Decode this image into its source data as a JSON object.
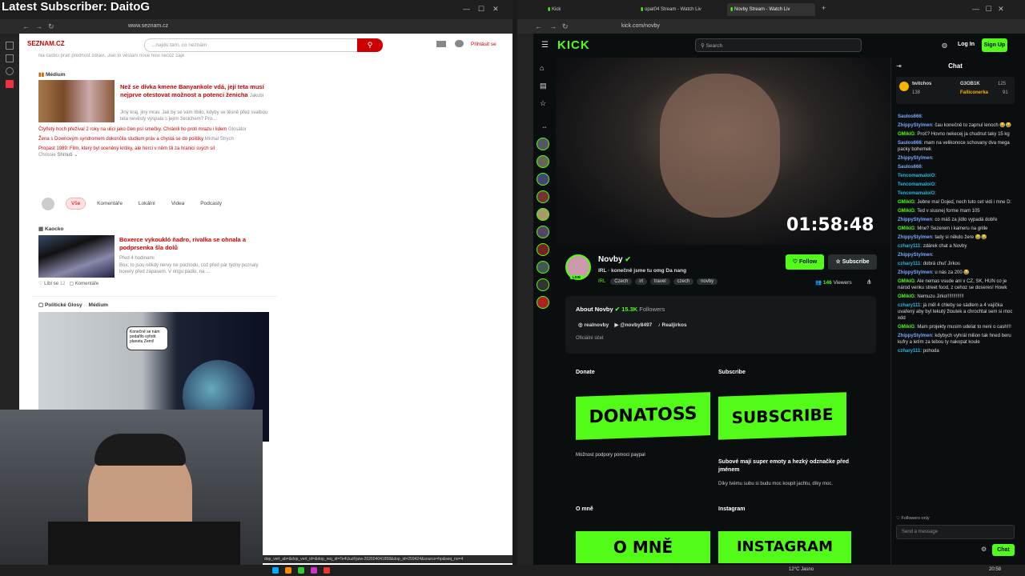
{
  "overlay": {
    "title": "Latest Subscriber: DaitoG"
  },
  "left_browser": {
    "url": "www.seznam.cz",
    "logo": "SEZNAM.CZ",
    "search_placeholder": "...najdu tam, co neznám",
    "login": "Přihlásit se",
    "cut_text": "Na častici prátí předhost zdraví. Jsel to věstání nové novi necož zaje",
    "medium_source": "Médium",
    "headline": "Než se dívka kmene Banyankole vdá, její teta musí nejprve otestovat možnost a potenci ženicha",
    "headline_author": "Jakubi",
    "headline_excerpt": "Jiný kraj, jiný mrav. Jak by se vám líbilo, kdyby se těsně před svatbou teta nevěsty vyspala s jejím ženichem? Pro...",
    "links": [
      {
        "title": "Čtyřletý hoch přežíval 2 roky na ulici jako člen psí smečky. Chránili ho proti mrazu i lidem",
        "source": "Glosátor"
      },
      {
        "title": "Žena s Downovým syndromem dokončila studium práv a chystá se do politiky",
        "source": "Michal Strych"
      },
      {
        "title": "Propast 1989: Film, který byl oceněný kritiky, ale herci v něm šli za hranici svých sil",
        "source": "Chrissie",
        "extra": "Shrnutí ⌄"
      }
    ],
    "filters": [
      "Vše",
      "Komentáře",
      "Lokální",
      "Videa",
      "Podcasty"
    ],
    "kaocko_source": "Kaocko",
    "kaocko_title": "Boxerce vykoukló ňadro, rivalka se ohnala a podprsenka šla dolů",
    "kaocko_meta": "Před 4 hodinami",
    "kaocko_text": "Box, to jsou někdy nervy ne pochodu, což před pár týdny poznaly boxery před zápasem. V ringu padlo, na ...",
    "likes": "Líbí se",
    "likes_count": "12",
    "comments": "Komentáře",
    "glosy_source": "Politické Glosy",
    "glosy_medium": "Médium",
    "comic_text": "Konečně se nám podařilo vyfotit planetu Zemi!",
    "status_url": "dop_vert_ab=&dop_vert_id=&dop_req_id=Te4UuzFjuiw-202604041858&dop_id=259424&source=hp&seq_no=4"
  },
  "right_browser": {
    "tabs": [
      "Kick",
      "opat04 Stream - Watch Liv",
      "Novby Stream - Watch Liv"
    ],
    "url": "kick.com/novby",
    "search_placeholder": "Search",
    "login": "Log In",
    "signup": "Sign Up",
    "timer": "01:58:48",
    "streamer": "Novby",
    "stream_title": "IRL · konečně jsme tu omg Da nang",
    "category": "IRL",
    "tags": [
      "Czech",
      "irl",
      "travel",
      "czech",
      "novby"
    ],
    "follow": "Follow",
    "subscribe": "Subscribe",
    "viewers": "146",
    "viewers_label": "Viewers",
    "about": "About Novby",
    "followers": "15.3K",
    "followers_label": "Followers",
    "socials": [
      "realnovby",
      "@novby8497",
      "Realjirkos"
    ],
    "official": "Oficiální účet",
    "donate_title": "Donate",
    "donate_banner": "DONATOSS",
    "donate_desc": "Možnost podpory pomocí paypal",
    "subscribe_title": "Subscribe",
    "subscribe_banner": "SUBSCRIBE",
    "subscribe_desc": "Subové mají super emoty a hezký odznačke před jménem",
    "subscribe_desc2": "Díky tvému subu si budu moc koupit jachtu, díky moc.",
    "omne_title": "O mně",
    "omne_banner": "O MNĚ",
    "instagram_title": "Instagram",
    "instagram_banner": "INSTAGRAM",
    "chat_title": "Chat",
    "pinned": {
      "user1": "twitchos",
      "count1": "138",
      "user2": "G3OB1K",
      "count2": "125",
      "user3": "Falliconerka",
      "count3": "91"
    },
    "chat": [
      {
        "u": "Saulos666",
        "c": "blue",
        "m": ""
      },
      {
        "u": "ZhippyStylmen",
        "c": "blue",
        "m": "čau konečně to zapnul lenoch 😂😂"
      },
      {
        "u": "GMikiG",
        "c": "green",
        "m": "Proč? Hovno nekecej ja chudnut taky 15 kg"
      },
      {
        "u": "Saulos666",
        "c": "blue",
        "m": "mam na velikonoce schovany dva mega packy bohemek"
      },
      {
        "u": "ZhippyStylmen",
        "c": "blue",
        "m": ""
      },
      {
        "u": "Saulos666",
        "c": "blue",
        "m": ""
      },
      {
        "u": "TencomamaloiO",
        "c": "cyan",
        "m": ""
      },
      {
        "u": "TencomamaloiO",
        "c": "cyan",
        "m": ""
      },
      {
        "u": "TencomamaloiO",
        "c": "cyan",
        "m": ""
      },
      {
        "u": "GMikiG",
        "c": "green",
        "m": "Jebne ma! Dojed, nech tuto cet vidi i mne D:"
      },
      {
        "u": "GMikiG",
        "c": "green",
        "m": "Ted v slusnej forme mam 105"
      },
      {
        "u": "ZhippyStylmen",
        "c": "blue",
        "m": "co máš za jídlo vypadá dobře"
      },
      {
        "u": "GMikiG",
        "c": "green",
        "m": "Mne? Sezerem i kameru na grille"
      },
      {
        "u": "ZhippyStylmen",
        "c": "blue",
        "m": "tady si někdo žere 😂😂"
      },
      {
        "u": "czhary111",
        "c": "cyan",
        "m": "zdárek chat a Novby"
      },
      {
        "u": "ZhippyStylmen",
        "c": "blue",
        "m": ""
      },
      {
        "u": "czhary111",
        "c": "cyan",
        "m": "dobrá chuť Jirkos"
      },
      {
        "u": "ZhippyStylmen",
        "c": "blue",
        "m": "u nás za 200 😂"
      },
      {
        "u": "GMikiG",
        "c": "green",
        "m": "Ale nemas vsude ani v CZ, SK, HUN co je národ venku street food, z cehoz se doseres! Howk"
      },
      {
        "u": "GMikiG",
        "c": "green",
        "m": "Nemuzu Jirko!!!!!!!!!!!!!"
      },
      {
        "u": "czhary111",
        "c": "cyan",
        "m": "já měl 4 chleby se sádlem a 4 vajíčka uvařený aby byl tekutý žloutek a chrochtal sem si moc xdd"
      },
      {
        "u": "GMikiG",
        "c": "green",
        "m": "Mam projekty musim udelat to neni o cash!!!"
      },
      {
        "u": "ZhippyStylmen",
        "c": "blue",
        "m": "kdybych vyhrál milion tak hned beru kufry a letím za tebou ty nakopat koule"
      },
      {
        "u": "czhary111",
        "c": "cyan",
        "m": "pohoda"
      }
    ],
    "followers_only": "Followers only",
    "send_placeholder": "Send a message",
    "chat_button": "Chat"
  },
  "taskbar": {
    "weather": "12°C Jasno",
    "time": "20:58"
  },
  "colors": {
    "kick_green": "#53fc18",
    "seznam_red": "#cc0000"
  }
}
